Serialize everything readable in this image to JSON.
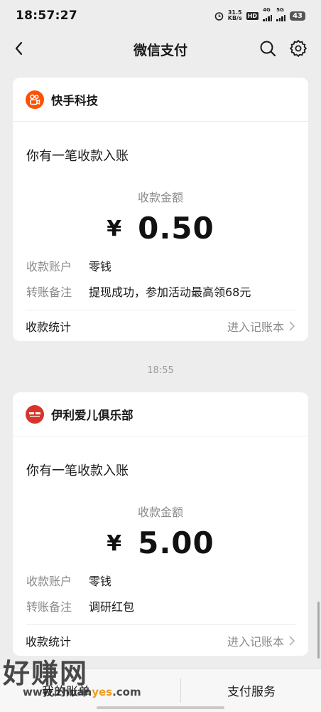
{
  "status_bar": {
    "time": "18:57:27",
    "net_speed_value": "31.5",
    "net_speed_unit": "KB/s",
    "hd_label": "HD",
    "signal1_label": "4G",
    "signal2_label": "5G",
    "battery": "43"
  },
  "nav": {
    "title": "微信支付"
  },
  "messages": [
    {
      "merchant": "快手科技",
      "logo_color": "#ff5000",
      "title": "你有一笔收款入账",
      "amount_label": "收款金额",
      "currency": "¥",
      "amount": "0.50",
      "account_label": "收款账户",
      "account_value": "零钱",
      "note_label": "转账备注",
      "note_value": "提现成功，参加活动最高领68元",
      "stats_label": "收款统计",
      "stats_link": "进入记账本"
    },
    {
      "merchant": "伊利爱儿俱乐部",
      "logo_color": "#d9342b",
      "title": "你有一笔收款入账",
      "amount_label": "收款金额",
      "currency": "¥",
      "amount": "5.00",
      "account_label": "收款账户",
      "account_value": "零钱",
      "note_label": "转账备注",
      "note_value": "调研红包",
      "stats_label": "收款统计",
      "stats_link": "进入记账本"
    }
  ],
  "timestamp": "18:55",
  "bottom_bar": {
    "left": "我的账单",
    "right": "支付服务"
  },
  "watermark": {
    "big": "好赚网",
    "small_prefix": "www.zhuan",
    "small_highlight": "yes",
    "small_suffix": ".com"
  }
}
